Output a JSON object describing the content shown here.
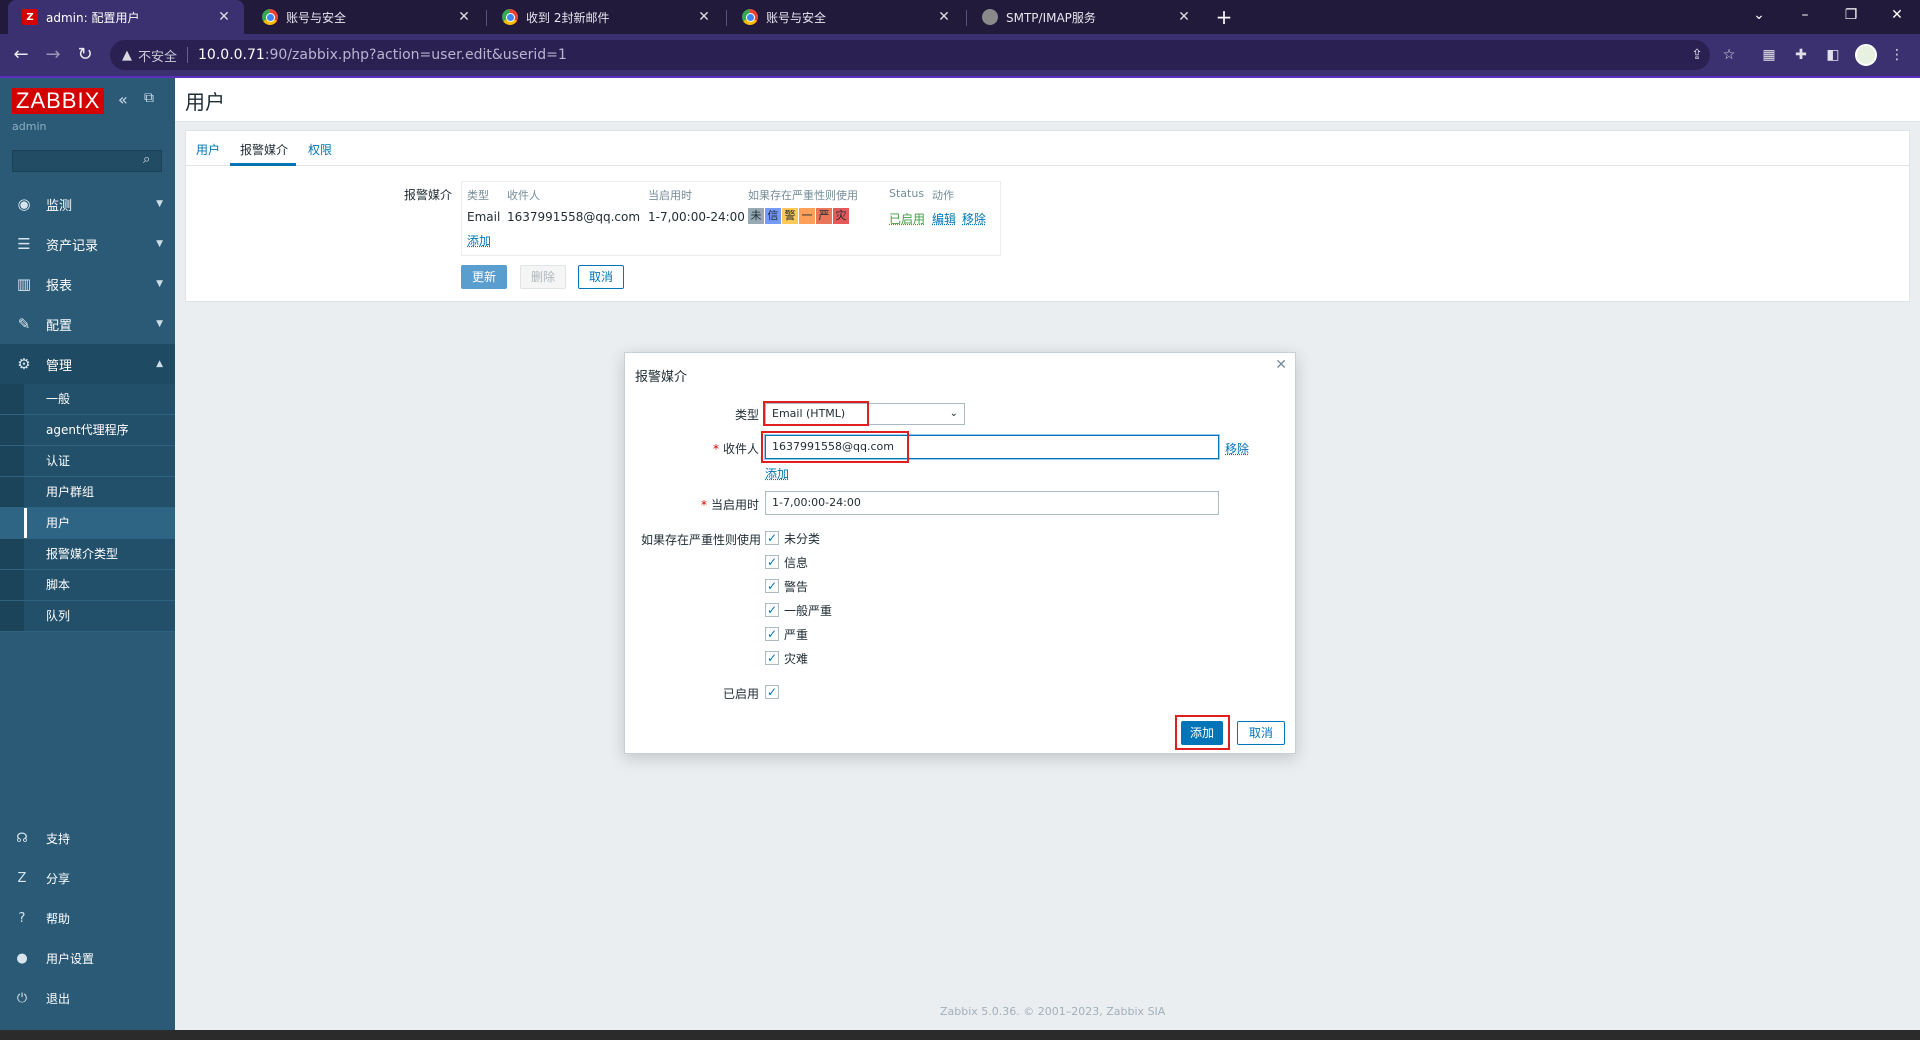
{
  "browser": {
    "tabs": [
      {
        "title": "admin: 配置用户",
        "favicon": "zabbix-icon",
        "active": true
      },
      {
        "title": "账号与安全",
        "favicon": "chrome-icon"
      },
      {
        "title": "收到 2封新邮件",
        "favicon": "chrome-icon"
      },
      {
        "title": "账号与安全",
        "favicon": "chrome-icon"
      },
      {
        "title": "SMTP/IMAP服务",
        "favicon": "globe-icon"
      }
    ],
    "insecure_label": "不安全",
    "url_host": "10.0.0.71",
    "url_path": ":90/zabbix.php?action=user.edit&userid=1"
  },
  "sidebar": {
    "logo": "ZABBIX",
    "user": "admin",
    "menu": [
      {
        "label": "监测",
        "icon": "eye-icon"
      },
      {
        "label": "资产记录",
        "icon": "list-icon"
      },
      {
        "label": "报表",
        "icon": "chart-icon"
      },
      {
        "label": "配置",
        "icon": "wrench-icon"
      },
      {
        "label": "管理",
        "icon": "gear-icon"
      }
    ],
    "admin_items": [
      "一般",
      "agent代理程序",
      "认证",
      "用户群组",
      "用户",
      "报警媒介类型",
      "脚本",
      "队列"
    ],
    "bottom": [
      {
        "label": "支持",
        "icon": "headset-icon"
      },
      {
        "label": "分享",
        "icon": "share-icon"
      },
      {
        "label": "帮助",
        "icon": "help-icon"
      },
      {
        "label": "用户设置",
        "icon": "user-icon"
      },
      {
        "label": "退出",
        "icon": "power-icon"
      }
    ]
  },
  "page": {
    "title": "用户",
    "tabs": [
      "用户",
      "报警媒介",
      "权限"
    ],
    "media_label": "报警媒介",
    "media_headers": [
      "类型",
      "收件人",
      "当启用时",
      "如果存在严重性则使用",
      "Status",
      "动作"
    ],
    "media_row": {
      "type": "Email",
      "sendto": "1637991558@qq.com",
      "when": "1-7,00:00-24:00",
      "severities": [
        "未",
        "信",
        "警",
        "一",
        "严",
        "灾"
      ],
      "status": "已启用",
      "edit": "编辑",
      "remove": "移除"
    },
    "add_link": "添加",
    "buttons": {
      "update": "更新",
      "delete": "删除",
      "cancel": "取消"
    }
  },
  "dialog": {
    "title": "报警媒介",
    "type_label": "类型",
    "type_value": "Email (HTML)",
    "sendto_label": "收件人",
    "sendto_value": "1637991558@qq.com",
    "remove_link": "移除",
    "add_link": "添加",
    "when_label": "当启用时",
    "when_value": "1-7,00:00-24:00",
    "severity_label": "如果存在严重性则使用",
    "severities": [
      "未分类",
      "信息",
      "警告",
      "一般严重",
      "严重",
      "灾难"
    ],
    "enabled_label": "已启用",
    "add_button": "添加",
    "cancel_button": "取消"
  },
  "footer": "Zabbix 5.0.36. © 2001–2023, Zabbix SIA",
  "colors": {
    "sidebar": "#2b5a76",
    "accent": "#0275b8",
    "brand": "#d40000",
    "highlight": "#e02020"
  }
}
